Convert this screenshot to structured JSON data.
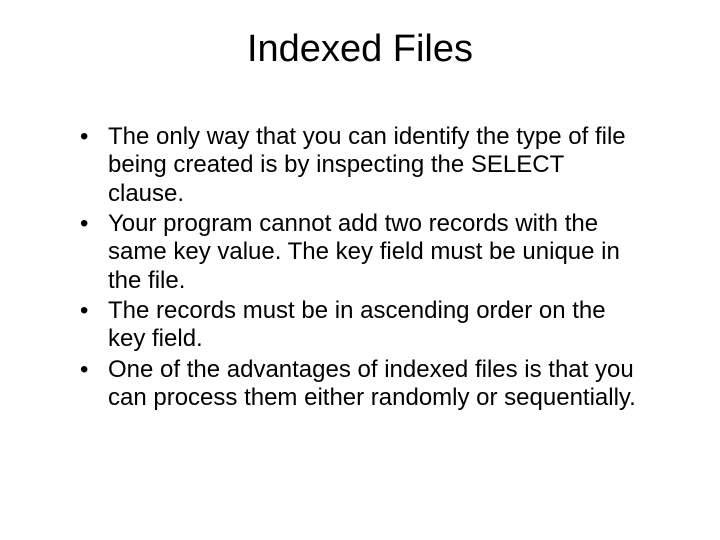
{
  "slide": {
    "title": "Indexed Files",
    "bullets": [
      "The only way that you can identify the type of file being created is by inspecting the SELECT clause.",
      "Your program cannot add two records with the same key value. The key field must be unique in the file.",
      "The records must be in ascending order on the key field.",
      "One of the advantages of indexed files is that you can process them either randomly or sequentially."
    ]
  }
}
